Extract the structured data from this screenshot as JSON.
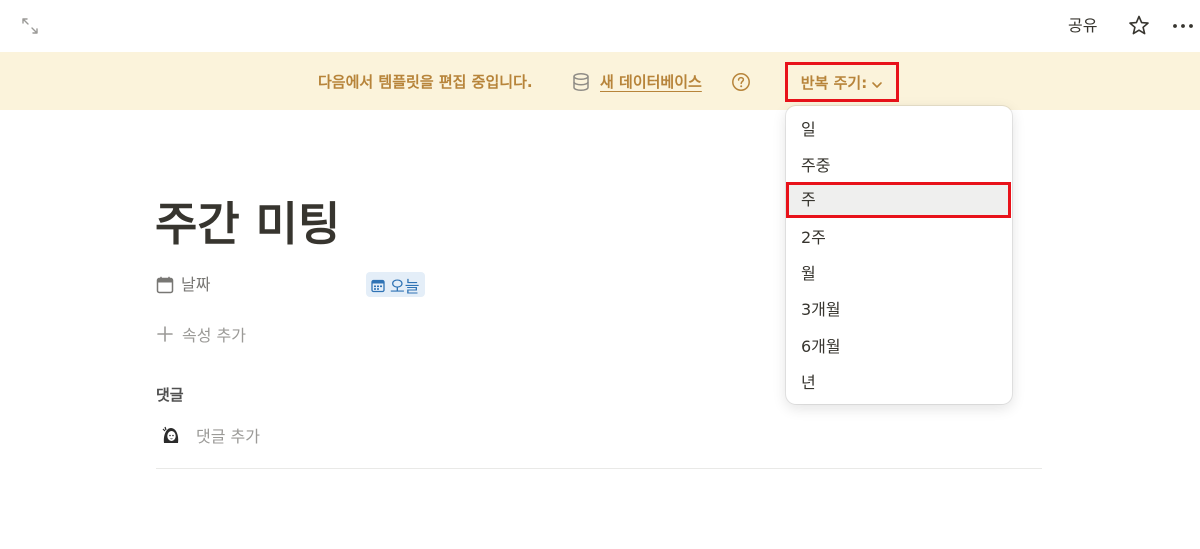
{
  "topbar": {
    "expand_icon": "expand-arrows-icon",
    "share_label": "공유",
    "star_icon": "star-icon",
    "more_icon": "more-dots-icon"
  },
  "banner": {
    "message": "다음에서 템플릿을 편집 중입니다.",
    "database_icon": "database-icon",
    "database_link": "새 데이터베이스",
    "help_icon": "question-circle-icon",
    "repeat_label": "반복 주기:",
    "background_color": "#fbf3db",
    "text_color": "#b7843a"
  },
  "repeat_menu": {
    "items": [
      {
        "label": "일"
      },
      {
        "label": "주중"
      },
      {
        "label": "주"
      },
      {
        "label": "2주"
      },
      {
        "label": "월"
      },
      {
        "label": "3개월"
      },
      {
        "label": "6개월"
      },
      {
        "label": "년"
      }
    ],
    "selected": "주",
    "highlight_color": "#e8121a"
  },
  "page": {
    "title": "주간 미팅",
    "properties": [
      {
        "icon": "calendar-icon",
        "label": "날짜",
        "value": "오늘",
        "value_icon": "calendar-icon"
      }
    ],
    "add_property_label": "속성 추가",
    "comments_heading": "댓글",
    "comment_placeholder": "댓글 추가",
    "avatar": "user-avatar"
  }
}
